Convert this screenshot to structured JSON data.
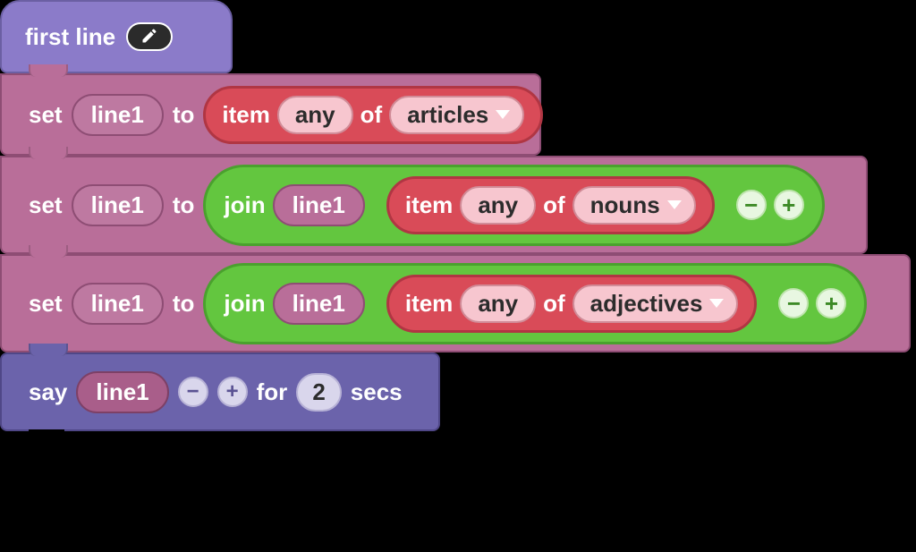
{
  "hat": {
    "name": "first line"
  },
  "common": {
    "set": "set",
    "to": "to",
    "item": "item",
    "of": "of",
    "any": "any",
    "join": "join",
    "say": "say",
    "for": "for",
    "secs": "secs",
    "minus": "−",
    "plus": "+"
  },
  "rows": [
    {
      "var": "line1",
      "item_index": "any",
      "list": "articles"
    },
    {
      "var": "line1",
      "join_ref": "line1",
      "item_index": "any",
      "list": "nouns"
    },
    {
      "var": "line1",
      "join_ref": "line1",
      "item_index": "any",
      "list": "adjectives"
    }
  ],
  "say": {
    "var": "line1",
    "duration": "2"
  }
}
